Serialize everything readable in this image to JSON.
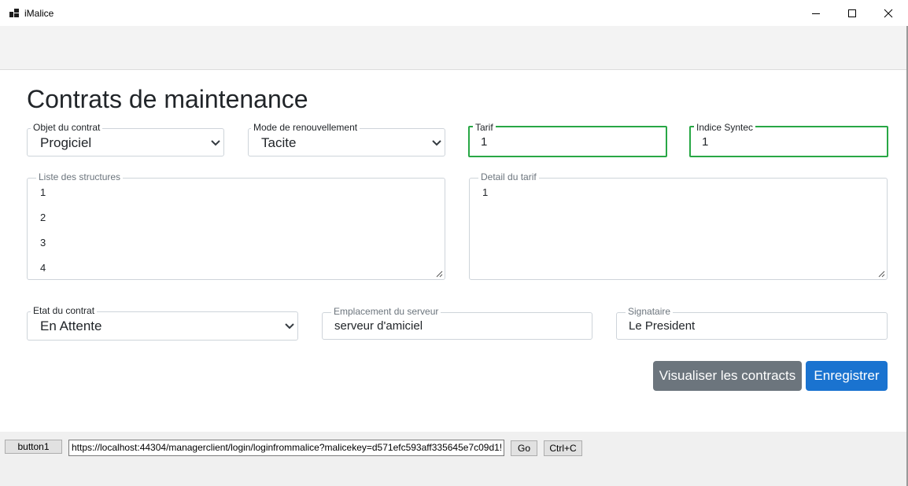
{
  "window": {
    "title": "iMalice",
    "icons": {
      "app": "app-icon",
      "minimize": "minimize-icon",
      "maximize": "maximize-icon",
      "close": "close-icon"
    }
  },
  "page": {
    "title": "Contrats de maintenance"
  },
  "form": {
    "objet": {
      "label": "Objet du contrat",
      "value": "Progiciel"
    },
    "mode": {
      "label": "Mode de renouvellement",
      "value": "Tacite"
    },
    "tarif": {
      "label": "Tarif",
      "value": "1"
    },
    "indice": {
      "label": "Indice Syntec",
      "value": "1"
    },
    "structures": {
      "label": "Liste des structures",
      "lines": [
        "1",
        "2",
        "3",
        "4"
      ]
    },
    "detail_tarif": {
      "label": "Detail du tarif",
      "lines": [
        "1"
      ]
    },
    "etat": {
      "label": "Etat du contrat",
      "value": "En Attente"
    },
    "emplacement": {
      "label": "Emplacement du serveur",
      "value": "serveur d'amiciel"
    },
    "signataire": {
      "label": "Signataire",
      "value": "Le President"
    }
  },
  "actions": {
    "visualiser": "Visualiser les contracts",
    "enregistrer": "Enregistrer"
  },
  "toolbar": {
    "button1": "button1",
    "url": "https://localhost:44304/managerclient/login/loginfrommalice?malicekey=d571efc593aff335645e7c09d1!",
    "go": "Go",
    "copy": "Ctrl+C"
  },
  "colors": {
    "valid_border": "#28a745",
    "primary": "#1a73d0",
    "secondary": "#6c757d"
  }
}
